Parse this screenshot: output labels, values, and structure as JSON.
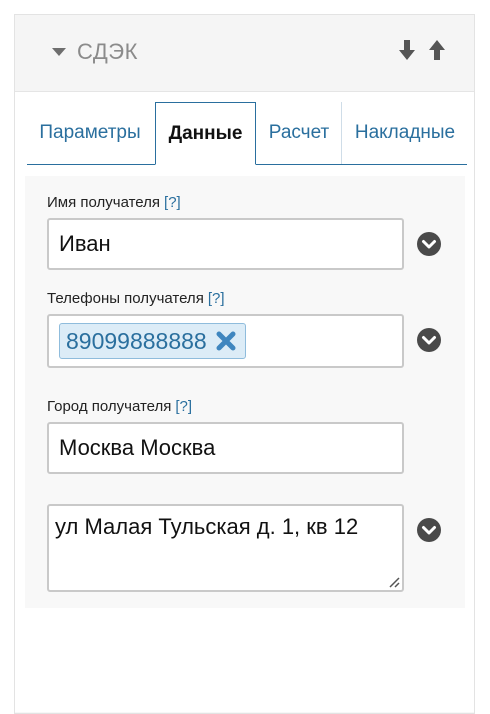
{
  "panel": {
    "title": "СДЭК"
  },
  "tabs": [
    {
      "label": "Параметры"
    },
    {
      "label": "Данные"
    },
    {
      "label": "Расчет"
    },
    {
      "label": "Накладные"
    }
  ],
  "form": {
    "recipient_name": {
      "label": "Имя получателя",
      "help": "[?]",
      "value": "Иван"
    },
    "recipient_phones": {
      "label": "Телефоны получателя",
      "help": "[?]",
      "tags": [
        "89099888888"
      ]
    },
    "recipient_city": {
      "label": "Город получателя",
      "help": "[?]",
      "value": "Москва Москва"
    },
    "address": {
      "value": "ул Малая Тульская д. 1, кв 12"
    }
  },
  "colors": {
    "accent": "#2a6f9e",
    "chip_bg": "#dcecf7",
    "expand_btn": "#4a4a4a"
  }
}
